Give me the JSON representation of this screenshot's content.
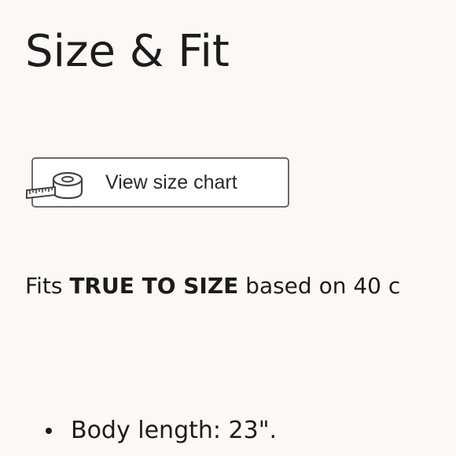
{
  "section": {
    "title": "Size & Fit"
  },
  "size_chart_button": {
    "label": "View size chart",
    "icon": "tape-measure-icon"
  },
  "fit": {
    "prefix": "Fits ",
    "emphasis": "TRUE TO SIZE",
    "suffix": " based on 40 c"
  },
  "details": {
    "items": [
      {
        "text": "Body length: 23\"."
      }
    ]
  },
  "colors": {
    "background": "#fcf8f5",
    "text": "#1c1c1c",
    "button_border": "#6b6b6b",
    "button_background": "#ffffff"
  }
}
